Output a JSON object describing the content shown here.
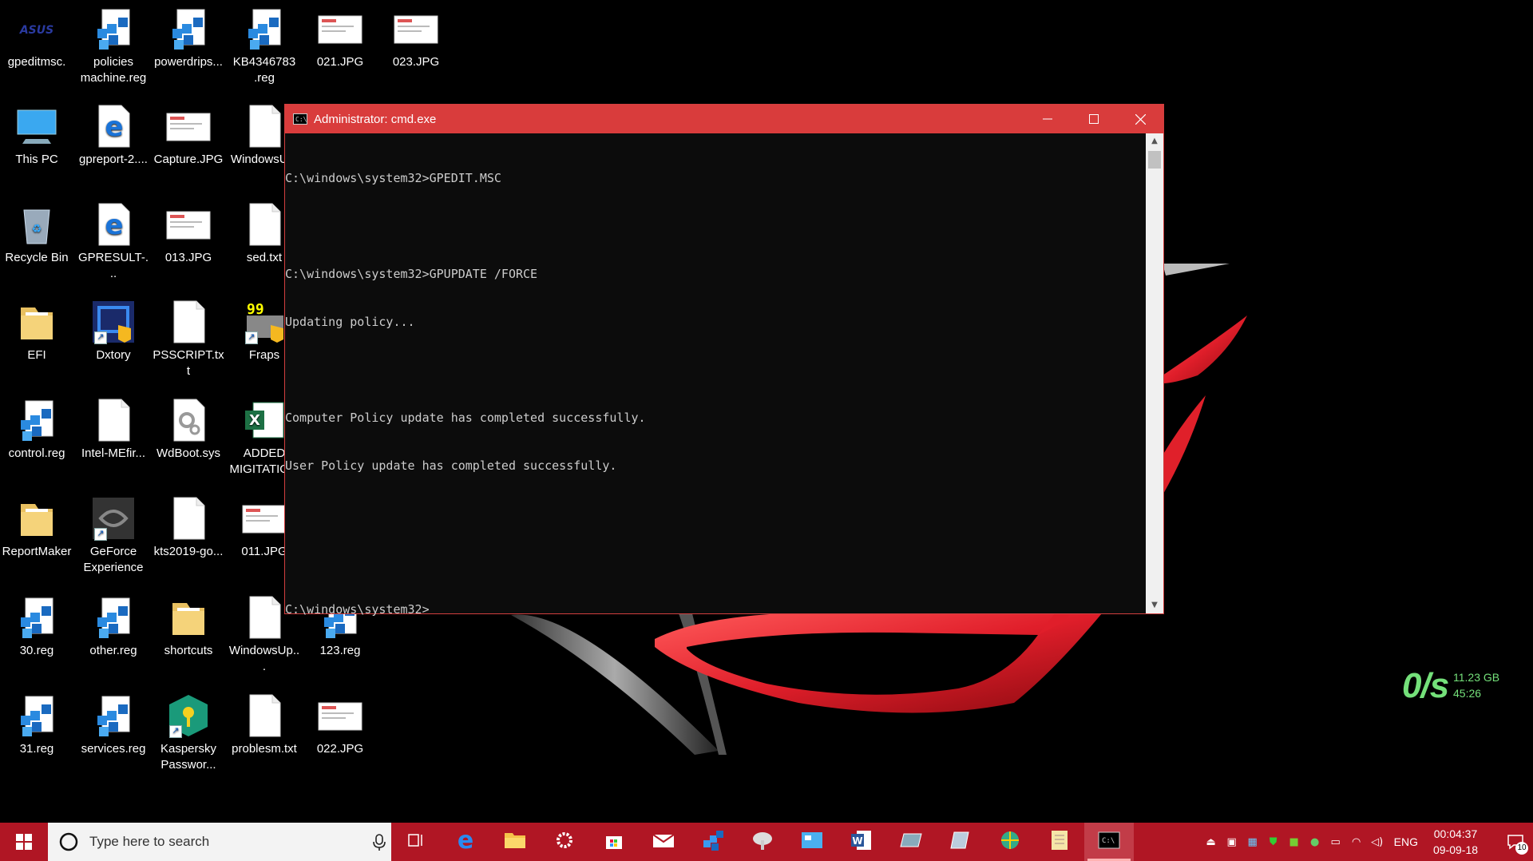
{
  "desktop": {
    "icons": [
      {
        "label": "gpeditmsc.",
        "type": "asus"
      },
      {
        "label": "policies machine.reg",
        "type": "reg"
      },
      {
        "label": "powerdrips...",
        "type": "reg"
      },
      {
        "label": "KB4346783 .reg",
        "type": "reg"
      },
      {
        "label": "021.JPG",
        "type": "jpg"
      },
      {
        "label": "023.JPG",
        "type": "jpg"
      },
      {
        "label": "This PC",
        "type": "pc"
      },
      {
        "label": "gpreport-2....",
        "type": "edge"
      },
      {
        "label": "Capture.JPG",
        "type": "jpg"
      },
      {
        "label": "WindowsU...",
        "type": "doc"
      },
      {
        "label": "Recycle Bin",
        "type": "bin"
      },
      {
        "label": "GPRESULT-...",
        "type": "edge"
      },
      {
        "label": "013.JPG",
        "type": "jpg"
      },
      {
        "label": "sed.txt",
        "type": "doc"
      },
      {
        "label": "EFI",
        "type": "folder"
      },
      {
        "label": "Dxtory",
        "type": "dxtory"
      },
      {
        "label": "PSSCRIPT.txt",
        "type": "doc"
      },
      {
        "label": "Fraps",
        "type": "fraps"
      },
      {
        "label": "control.reg",
        "type": "reg"
      },
      {
        "label": "Intel-MEfir...",
        "type": "doc"
      },
      {
        "label": "WdBoot.sys",
        "type": "sys"
      },
      {
        "label": "ADDED MIGITATIO...",
        "type": "excel"
      },
      {
        "label": "ReportMaker",
        "type": "folder"
      },
      {
        "label": "GeForce Experience",
        "type": "geforce"
      },
      {
        "label": "kts2019-go...",
        "type": "doc"
      },
      {
        "label": "011.JPG",
        "type": "jpg"
      },
      {
        "label": "30.reg",
        "type": "reg"
      },
      {
        "label": "other.reg",
        "type": "reg"
      },
      {
        "label": "shortcuts",
        "type": "folder"
      },
      {
        "label": "WindowsUp...",
        "type": "doc"
      },
      {
        "label": "123.reg",
        "type": "reg"
      },
      {
        "label": "31.reg",
        "type": "reg"
      },
      {
        "label": "services.reg",
        "type": "reg"
      },
      {
        "label": "Kaspersky Passwor...",
        "type": "kaspersky"
      },
      {
        "label": "problesm.txt",
        "type": "doc"
      },
      {
        "label": "022.JPG",
        "type": "jpg"
      }
    ]
  },
  "cmd": {
    "title": "Administrator: cmd.exe",
    "lines": [
      "C:\\windows\\system32>GPEDIT.MSC",
      "",
      "C:\\windows\\system32>GPUPDATE /FORCE",
      "Updating policy...",
      "",
      "Computer Policy update has completed successfully.",
      "User Policy update has completed successfully.",
      "",
      "",
      "C:\\windows\\system32>"
    ]
  },
  "network_widget": {
    "speed": "0/s",
    "total": "11.23 GB",
    "time": "45:26"
  },
  "taskbar": {
    "search_placeholder": "Type here to search",
    "apps": [
      "task-view",
      "edge",
      "file-explorer",
      "settings",
      "store",
      "mail",
      "regedit",
      "paint-3d",
      "control-panel",
      "word",
      "photos",
      "notepad-app",
      "network-globe",
      "notes",
      "cmd"
    ],
    "language": "ENG",
    "time": "00:04:37",
    "date": "09-09-18",
    "notification_count": "10"
  },
  "colors": {
    "title_bar": "#d93c3c",
    "taskbar": "#b01624",
    "widget_green": "#74e07a"
  }
}
